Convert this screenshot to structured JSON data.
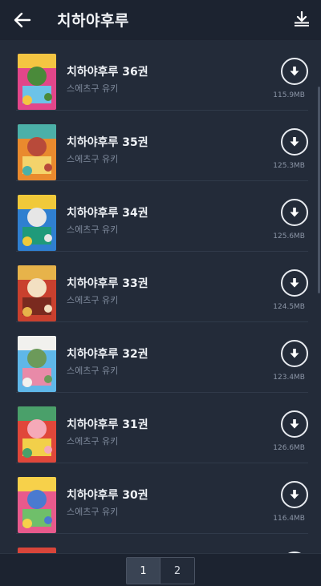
{
  "header": {
    "title": "치하야후루",
    "back_icon": "arrow-left-icon",
    "download_all_icon": "download-all-icon"
  },
  "items": [
    {
      "title": "치하야후루 36권",
      "author": "스에츠구 유키",
      "size": "115.9MB"
    },
    {
      "title": "치하야후루 35권",
      "author": "스에츠구 유키",
      "size": "125.3MB"
    },
    {
      "title": "치하야후루 34권",
      "author": "스에츠구 유키",
      "size": "125.6MB"
    },
    {
      "title": "치하야후루 33권",
      "author": "스에츠구 유키",
      "size": "124.5MB"
    },
    {
      "title": "치하야후루 32권",
      "author": "스에츠구 유키",
      "size": "123.4MB"
    },
    {
      "title": "치하야후루 31권",
      "author": "스에츠구 유키",
      "size": "126.6MB"
    },
    {
      "title": "치하야후루 30권",
      "author": "스에츠구 유키",
      "size": "116.4MB"
    }
  ],
  "pagination": {
    "pages": [
      "1",
      "2"
    ],
    "current": "1"
  },
  "colors": {
    "background": "#232b39",
    "appbar": "#1c2330"
  }
}
